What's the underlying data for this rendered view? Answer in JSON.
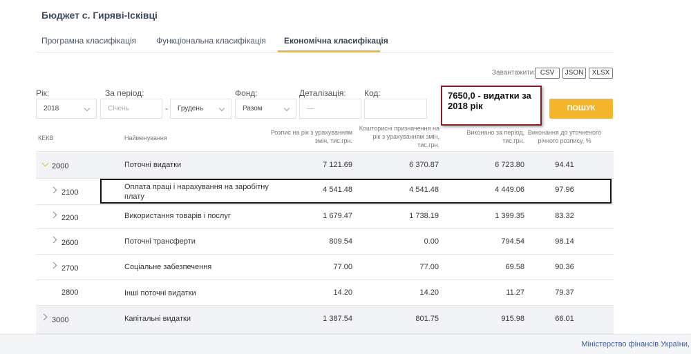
{
  "header": {
    "title": "Бюджет с. Гиряві-Ісківці"
  },
  "tabs": [
    {
      "label": "Програмна класифікація"
    },
    {
      "label": "Функціональна класифікація"
    },
    {
      "label": "Економічна класифікація"
    }
  ],
  "download": {
    "label": "Завантажити:",
    "buttons": [
      "CSV",
      "JSON",
      "XLSX"
    ]
  },
  "filters": {
    "year": {
      "label": "Рік:",
      "value": "2018"
    },
    "period": {
      "label": "За період:",
      "from_placeholder": "Січень",
      "separator": "-",
      "to": "Грудень"
    },
    "fund": {
      "label": "Фонд:",
      "value": "Разом"
    },
    "detail": {
      "label": "Деталізація:",
      "placeholder": "—"
    },
    "code": {
      "label": "Код:",
      "value": ""
    },
    "search_label": "ПОШУК"
  },
  "note": {
    "text": "7650,0 - видатки за 2018 рік"
  },
  "table": {
    "headers": {
      "code": "КЕКВ",
      "name": "Найменування",
      "plan_line1": "Розпис на рік з урахуванням",
      "plan_line2": "змін, тис.грн.",
      "budget_line1": "Кошторисні призначення на",
      "budget_line2": "рік з урахуванням змін,",
      "budget_line3": "тис.грн.",
      "done_line1": "Виконано за період,",
      "done_line2": "тис.грн.",
      "pct_line1": "Виконання до уточненого",
      "pct_line2": "річного розпису, %"
    },
    "rows": [
      {
        "code": "2000",
        "name": "Поточні видатки",
        "plan": "7 121.69",
        "budget": "6 370.87",
        "done": "6 723.80",
        "pct": "94.41"
      },
      {
        "code": "2100",
        "name_line1": "Оплата праці і нарахування на заробітну",
        "name_line2": "плату",
        "plan": "4 541.48",
        "budget": "4 541.48",
        "done": "4 449.06",
        "pct": "97.96"
      },
      {
        "code": "2200",
        "name": "Використання товарів і послуг",
        "plan": "1 679.47",
        "budget": "1 738.19",
        "done": "1 399.35",
        "pct": "83.32"
      },
      {
        "code": "2600",
        "name": "Поточні трансферти",
        "plan": "809.54",
        "budget": "0.00",
        "done": "794.54",
        "pct": "98.14"
      },
      {
        "code": "2700",
        "name": "Соціальне забезпечення",
        "plan": "77.00",
        "budget": "77.00",
        "done": "69.58",
        "pct": "90.36"
      },
      {
        "code": "2800",
        "name": "Інші поточні видатки",
        "plan": "14.20",
        "budget": "14.20",
        "done": "11.27",
        "pct": "79.37"
      },
      {
        "code": "3000",
        "name": "Капітальні видатки",
        "plan": "1 387.54",
        "budget": "801.75",
        "done": "915.98",
        "pct": "66.01"
      }
    ]
  },
  "footer": {
    "text": "Міністерство фінансів України,"
  },
  "colors": {
    "accent": "#f4b52a",
    "note_border": "#8a1d1d",
    "link": "#3a5aa0"
  }
}
